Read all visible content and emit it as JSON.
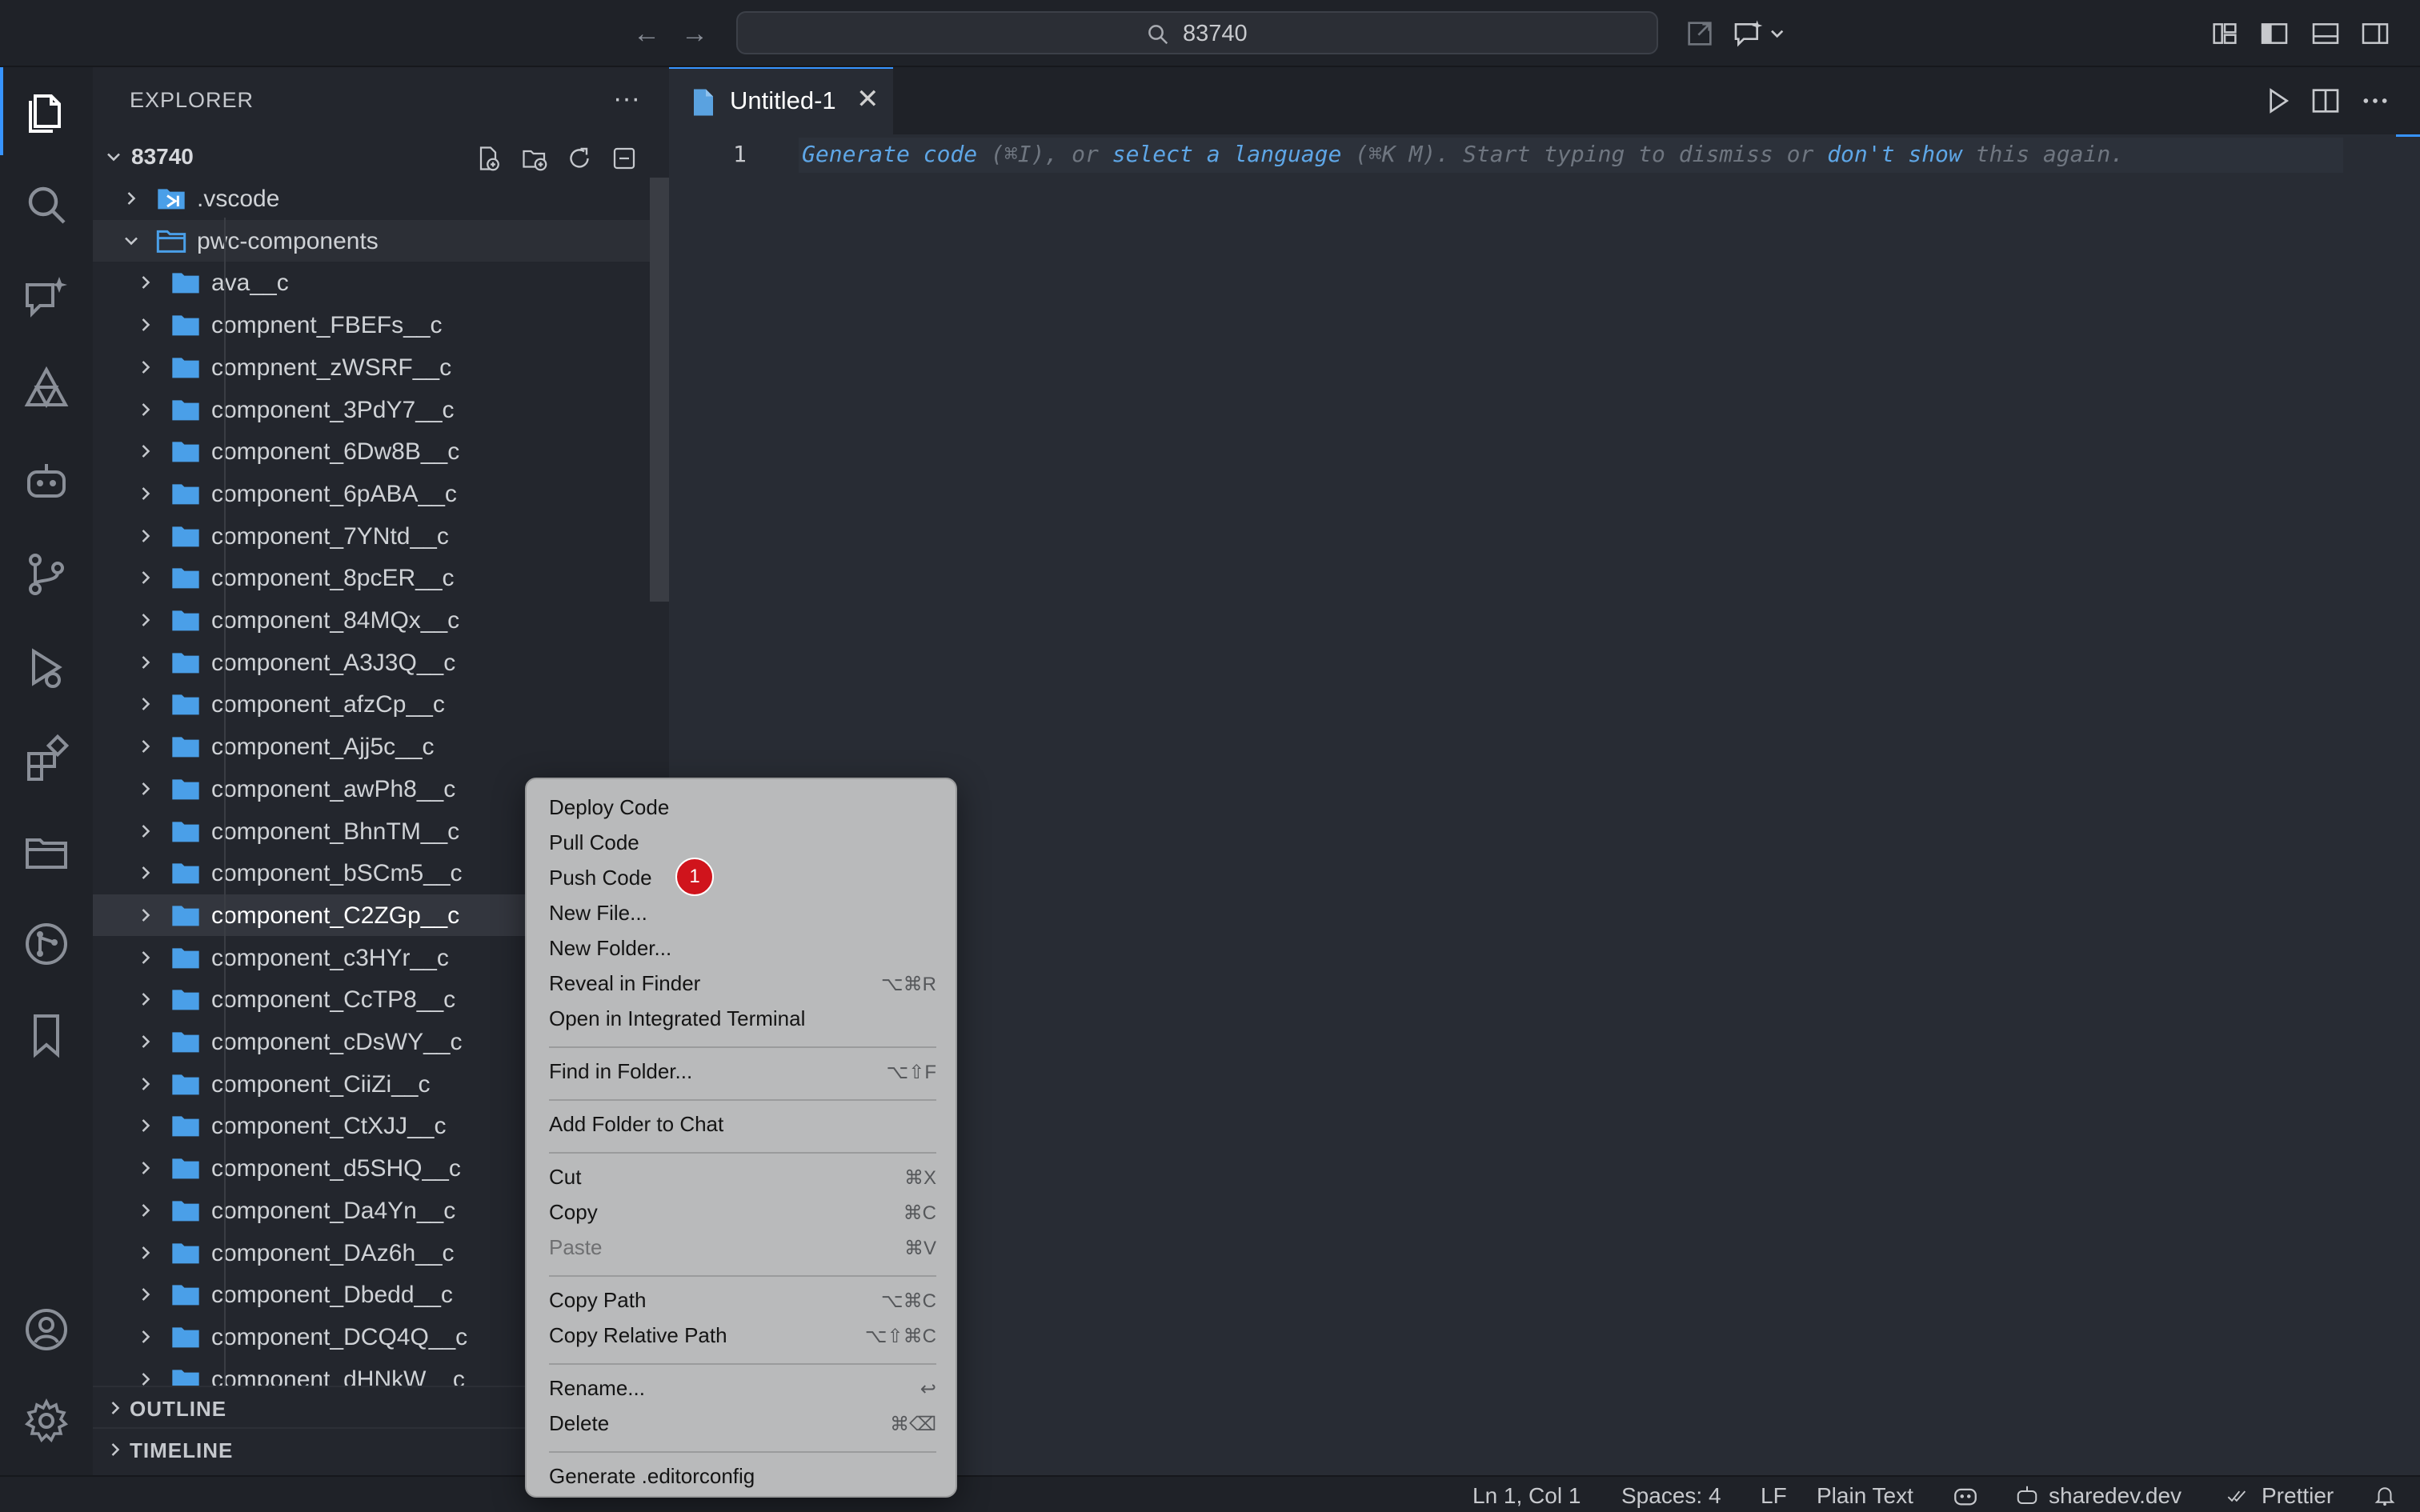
{
  "titlebar": {
    "search_text": "83740"
  },
  "sidebar": {
    "title": "EXPLORER",
    "more": "···",
    "folder_name": "83740",
    "tree": [
      {
        "label": ".vscode",
        "level": 1,
        "icon": "vscode-folder-icon"
      },
      {
        "label": "pwc-components",
        "level": 1,
        "expanded": true,
        "icon": "folder-open-icon"
      },
      {
        "label": "ava__c",
        "level": 2
      },
      {
        "label": "compnent_FBEFs__c",
        "level": 2
      },
      {
        "label": "compnent_zWSRF__c",
        "level": 2
      },
      {
        "label": "component_3PdY7__c",
        "level": 2
      },
      {
        "label": "component_6Dw8B__c",
        "level": 2
      },
      {
        "label": "component_6pABA__c",
        "level": 2
      },
      {
        "label": "component_7YNtd__c",
        "level": 2
      },
      {
        "label": "component_8pcER__c",
        "level": 2
      },
      {
        "label": "component_84MQx__c",
        "level": 2
      },
      {
        "label": "component_A3J3Q__c",
        "level": 2
      },
      {
        "label": "component_afzCp__c",
        "level": 2
      },
      {
        "label": "component_Ajj5c__c",
        "level": 2
      },
      {
        "label": "component_awPh8__c",
        "level": 2
      },
      {
        "label": "component_BhnTM__c",
        "level": 2
      },
      {
        "label": "component_bSCm5__c",
        "level": 2
      },
      {
        "label": "component_C2ZGp__c",
        "level": 2,
        "selected": true
      },
      {
        "label": "component_c3HYr__c",
        "level": 2
      },
      {
        "label": "component_CcTP8__c",
        "level": 2
      },
      {
        "label": "component_cDsWY__c",
        "level": 2
      },
      {
        "label": "component_CiiZi__c",
        "level": 2
      },
      {
        "label": "component_CtXJJ__c",
        "level": 2
      },
      {
        "label": "component_d5SHQ__c",
        "level": 2
      },
      {
        "label": "component_Da4Yn__c",
        "level": 2
      },
      {
        "label": "component_DAz6h__c",
        "level": 2
      },
      {
        "label": "component_Dbedd__c",
        "level": 2
      },
      {
        "label": "component_DCQ4Q__c",
        "level": 2
      },
      {
        "label": "component_dHNkW__c",
        "level": 2
      }
    ],
    "sections": [
      "OUTLINE",
      "TIMELINE"
    ]
  },
  "editor": {
    "tab_label": "Untitled-1",
    "tab_close": "✕",
    "line_number": "1",
    "hint": {
      "p1": "Generate code",
      "p2": " (⌘I), or ",
      "p3": "select a language",
      "p4": " (⌘K M). Start typing to dismiss or ",
      "p5": "don't show",
      "p6": " this again."
    }
  },
  "context_menu": {
    "groups": [
      [
        {
          "label": "Deploy Code",
          "shortcut": ""
        },
        {
          "label": "Pull Code",
          "shortcut": ""
        },
        {
          "label": "Push Code",
          "shortcut": ""
        },
        {
          "label": "New File...",
          "shortcut": ""
        },
        {
          "label": "New Folder...",
          "shortcut": ""
        },
        {
          "label": "Reveal in Finder",
          "shortcut": "⌥⌘R"
        },
        {
          "label": "Open in Integrated Terminal",
          "shortcut": ""
        }
      ],
      [
        {
          "label": "Find in Folder...",
          "shortcut": "⌥⇧F"
        }
      ],
      [
        {
          "label": "Add Folder to Chat",
          "shortcut": ""
        }
      ],
      [
        {
          "label": "Cut",
          "shortcut": "⌘X"
        },
        {
          "label": "Copy",
          "shortcut": "⌘C"
        },
        {
          "label": "Paste",
          "shortcut": "⌘V",
          "disabled": true
        }
      ],
      [
        {
          "label": "Copy Path",
          "shortcut": "⌥⌘C"
        },
        {
          "label": "Copy Relative Path",
          "shortcut": "⌥⇧⌘C"
        }
      ],
      [
        {
          "label": "Rename...",
          "shortcut": "↩"
        },
        {
          "label": "Delete",
          "shortcut": "⌘⌫"
        }
      ],
      [
        {
          "label": "Generate .editorconfig",
          "shortcut": ""
        }
      ]
    ],
    "badge": "1"
  },
  "statusbar": {
    "position": "Ln 1, Col 1",
    "spaces": "Spaces: 4",
    "eol": "LF",
    "language": "Plain Text",
    "remote": "sharedev.dev",
    "formatter": "Prettier"
  },
  "colors": {
    "accent": "#3794ff",
    "folder": "#4a9fe8",
    "badge": "#d0141c"
  }
}
